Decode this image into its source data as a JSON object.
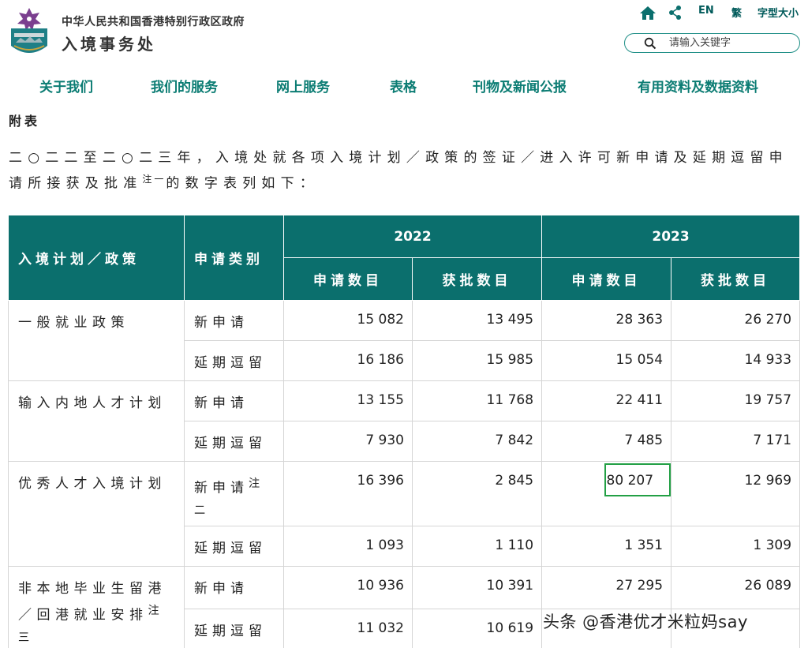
{
  "header": {
    "dept_line1": "中华人民共和国香港特别行政区政府",
    "dept_line2": "入境事务处",
    "logo_icon": "hk-immigration-crest",
    "utilities": {
      "home_icon": "home-icon",
      "share_icon": "share-icon",
      "en_label": "EN",
      "trad_label": "繁",
      "font_size_label": "字型大小"
    },
    "search": {
      "placeholder": "请输入关键字",
      "icon": "search-icon"
    }
  },
  "nav": {
    "items": [
      {
        "label": "关于我们"
      },
      {
        "label": "我们的服务"
      },
      {
        "label": "网上服务"
      },
      {
        "label": "表格"
      },
      {
        "label": "刊物及新闻公报"
      },
      {
        "label": "有用资料及数据资料"
      }
    ]
  },
  "content": {
    "appendix_title": "附表",
    "intro_text": "二○二二至二○二三年，入境处就各项入境计划／政策的签证／进入许可新申请及延期逗留申请所接获及批准",
    "intro_note": "注一",
    "intro_tail": "的数字表列如下："
  },
  "table": {
    "headers": {
      "policy": "入境计划／政策",
      "type": "申请类别",
      "year1": "2022",
      "year2": "2023",
      "received": "申请数目",
      "approved": "获批数目"
    },
    "groups": [
      {
        "policy": "一般就业政策",
        "policy_note": "",
        "rows": [
          {
            "type": "新申请",
            "type_note": "",
            "values": [
              "15 082",
              "13 495",
              "28 363",
              "26 270"
            ]
          },
          {
            "type": "延期逗留",
            "type_note": "",
            "values": [
              "16 186",
              "15 985",
              "15 054",
              "14 933"
            ]
          }
        ]
      },
      {
        "policy": "输入内地人才计划",
        "policy_note": "",
        "rows": [
          {
            "type": "新申请",
            "type_note": "",
            "values": [
              "13 155",
              "11 768",
              "22 411",
              "19 757"
            ]
          },
          {
            "type": "延期逗留",
            "type_note": "",
            "values": [
              "7 930",
              "7 842",
              "7 485",
              "7 171"
            ]
          }
        ]
      },
      {
        "policy": "优秀人才入境计划",
        "policy_note": "",
        "rows": [
          {
            "type": "新申请",
            "type_note": "注二",
            "values": [
              "16 396",
              "2 845",
              "80 207",
              "12 969"
            ]
          },
          {
            "type": "延期逗留",
            "type_note": "",
            "values": [
              "1 093",
              "1 110",
              "1 351",
              "1 309"
            ]
          }
        ]
      },
      {
        "policy": "非本地毕业生留港／回港就业安排",
        "policy_note": "注三",
        "rows": [
          {
            "type": "新申请",
            "type_note": "",
            "values": [
              "10 936",
              "10 391",
              "27 295",
              "26 089"
            ]
          },
          {
            "type": "延期逗留",
            "type_note": "",
            "values": [
              "11 032",
              "10 619",
              "",
              ""
            ]
          }
        ]
      }
    ],
    "highlight_color": "#23a045"
  },
  "watermark": "头条 @香港优才米粒妈say",
  "colors": {
    "brand_teal": "#0b6f6d",
    "nav_text": "#0b7c73",
    "highlight": "#23a045"
  }
}
